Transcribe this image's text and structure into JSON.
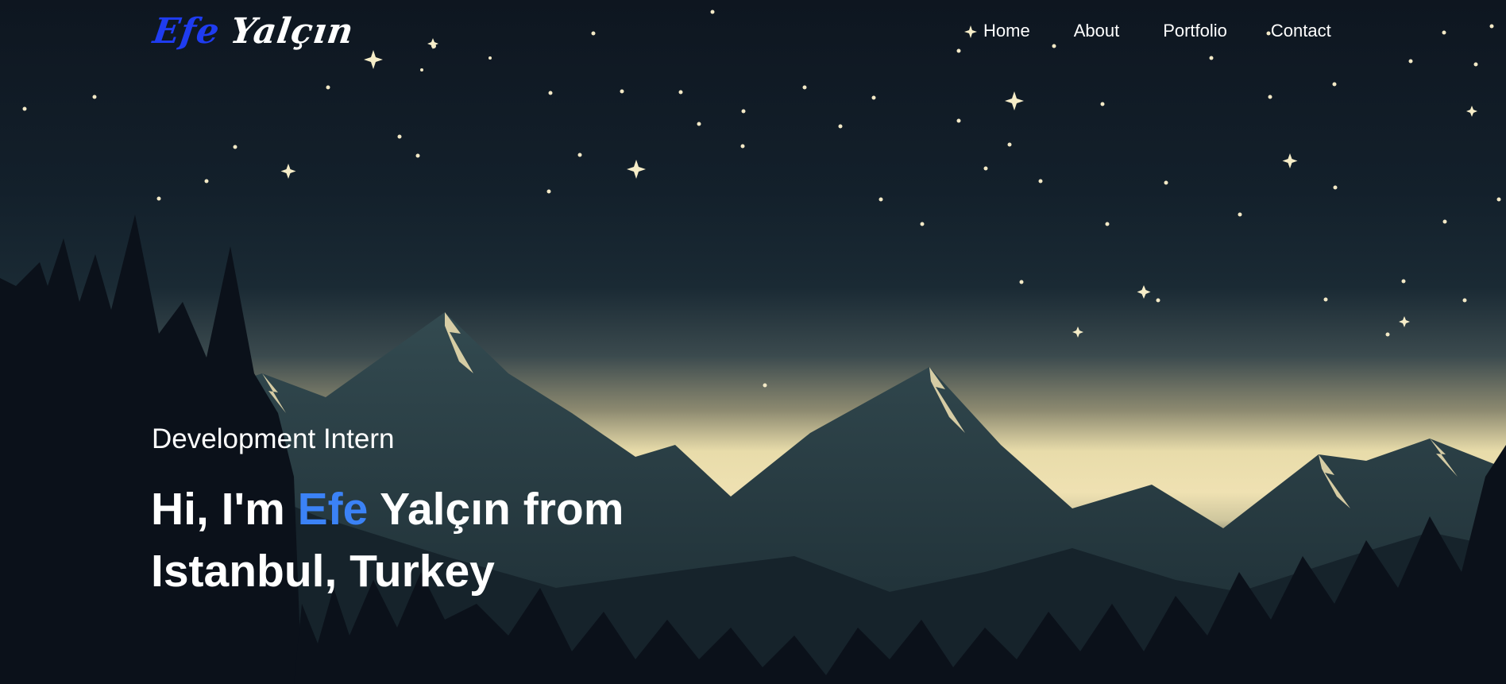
{
  "brand": {
    "first_name": "Efe",
    "last_name": "Yalçın",
    "first_color": "#1f3cf0",
    "last_color": "#ffffff"
  },
  "nav": {
    "items": [
      {
        "label": "Home"
      },
      {
        "label": "About"
      },
      {
        "label": "Portfolio"
      },
      {
        "label": "Contact"
      }
    ]
  },
  "hero": {
    "subtitle": "Development Intern",
    "headline_prefix": "Hi, I'm",
    "headline_name": "Efe",
    "headline_suffix": "Yalçın from",
    "headline_line2": "Istanbul, Turkey",
    "accent_color": "#3b82f6",
    "background": "night-mountain-landscape"
  }
}
